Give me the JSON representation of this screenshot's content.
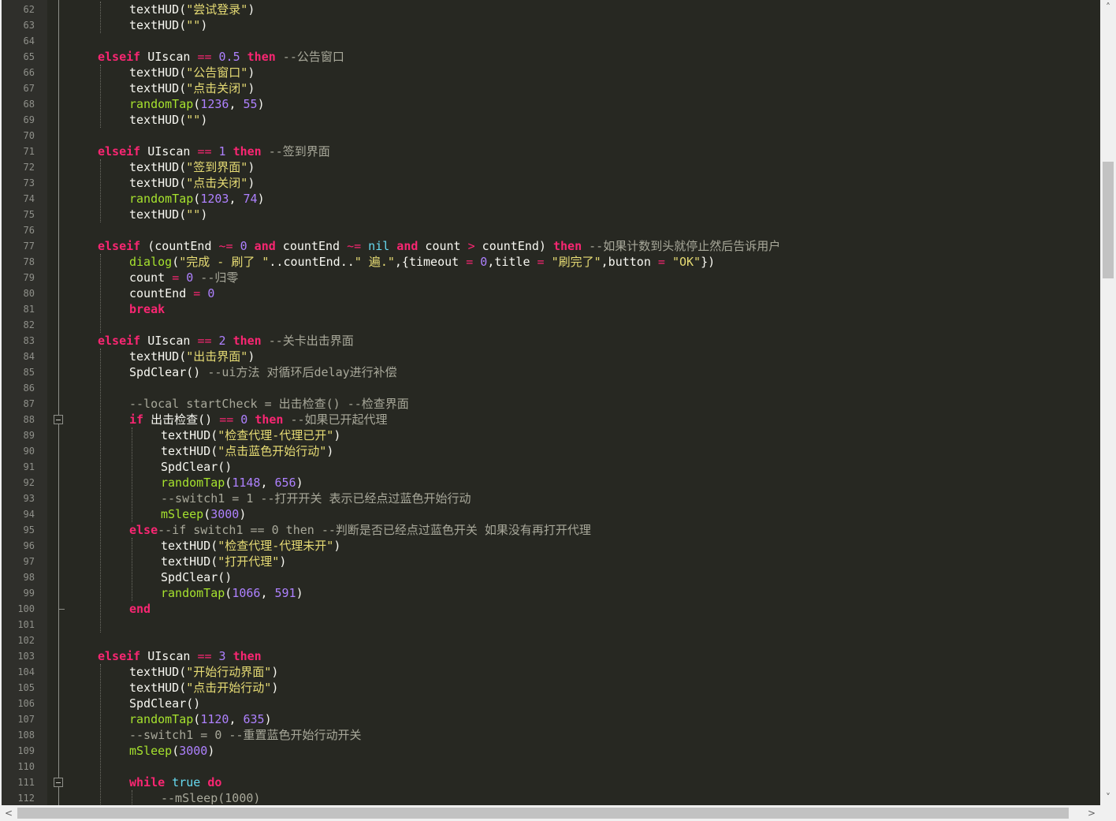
{
  "editor": {
    "lines": [
      {
        "n": "62",
        "indent": 2,
        "parts": [
          [
            "fn0",
            "textHUD("
          ],
          [
            "str",
            "\"尝试登录\""
          ],
          [
            "id",
            ")"
          ]
        ]
      },
      {
        "n": "63",
        "indent": 2,
        "parts": [
          [
            "id",
            "textHUD("
          ],
          [
            "str",
            "\"\""
          ],
          [
            "id",
            ")"
          ]
        ]
      },
      {
        "n": "64",
        "indent": 0,
        "parts": []
      },
      {
        "n": "65",
        "indent": 1,
        "parts": [
          [
            "kw",
            "elseif"
          ],
          [
            "id",
            " UIscan "
          ],
          [
            "op",
            "=="
          ],
          [
            "num",
            " 0.5"
          ],
          [
            "kw",
            " then"
          ],
          [
            "cmb",
            " --公告窗口"
          ]
        ]
      },
      {
        "n": "66",
        "indent": 2,
        "parts": [
          [
            "id",
            "textHUD("
          ],
          [
            "str",
            "\"公告窗口\""
          ],
          [
            "id",
            ")"
          ]
        ]
      },
      {
        "n": "67",
        "indent": 2,
        "parts": [
          [
            "id",
            "textHUD("
          ],
          [
            "str",
            "\"点击关闭\""
          ],
          [
            "id",
            ")"
          ]
        ]
      },
      {
        "n": "68",
        "indent": 2,
        "parts": [
          [
            "fn",
            "randomTap"
          ],
          [
            "id",
            "("
          ],
          [
            "num",
            "1236"
          ],
          [
            "id",
            ", "
          ],
          [
            "num",
            "55"
          ],
          [
            "id",
            ")"
          ]
        ]
      },
      {
        "n": "69",
        "indent": 2,
        "parts": [
          [
            "id",
            "textHUD("
          ],
          [
            "str",
            "\"\""
          ],
          [
            "id",
            ")"
          ]
        ]
      },
      {
        "n": "70",
        "indent": 0,
        "parts": []
      },
      {
        "n": "71",
        "indent": 1,
        "parts": [
          [
            "kw",
            "elseif"
          ],
          [
            "id",
            " UIscan "
          ],
          [
            "op",
            "=="
          ],
          [
            "num",
            " 1"
          ],
          [
            "kw",
            " then"
          ],
          [
            "cmb",
            " --签到界面"
          ]
        ]
      },
      {
        "n": "72",
        "indent": 2,
        "parts": [
          [
            "id",
            "textHUD("
          ],
          [
            "str",
            "\"签到界面\""
          ],
          [
            "id",
            ")"
          ]
        ]
      },
      {
        "n": "73",
        "indent": 2,
        "parts": [
          [
            "id",
            "textHUD("
          ],
          [
            "str",
            "\"点击关闭\""
          ],
          [
            "id",
            ")"
          ]
        ]
      },
      {
        "n": "74",
        "indent": 2,
        "parts": [
          [
            "fn",
            "randomTap"
          ],
          [
            "id",
            "("
          ],
          [
            "num",
            "1203"
          ],
          [
            "id",
            ", "
          ],
          [
            "num",
            "74"
          ],
          [
            "id",
            ")"
          ]
        ]
      },
      {
        "n": "75",
        "indent": 2,
        "parts": [
          [
            "id",
            "textHUD("
          ],
          [
            "str",
            "\"\""
          ],
          [
            "id",
            ")"
          ]
        ]
      },
      {
        "n": "76",
        "indent": 0,
        "parts": []
      },
      {
        "n": "77",
        "indent": 1,
        "parts": [
          [
            "kw",
            "elseif"
          ],
          [
            "id",
            " (countEnd "
          ],
          [
            "op",
            "~="
          ],
          [
            "num",
            " 0"
          ],
          [
            "kw",
            " and"
          ],
          [
            "id",
            " countEnd "
          ],
          [
            "op",
            "~="
          ],
          [
            "cy",
            " nil"
          ],
          [
            "kw",
            " and"
          ],
          [
            "id",
            " count "
          ],
          [
            "op",
            ">"
          ],
          [
            "id",
            " countEnd) "
          ],
          [
            "kw",
            "then"
          ],
          [
            "cmb",
            " --如果计数到头就停止然后告诉用户"
          ]
        ]
      },
      {
        "n": "78",
        "indent": 2,
        "parts": [
          [
            "fn",
            "dialog"
          ],
          [
            "id",
            "("
          ],
          [
            "str",
            "\"完成 - 刷了 \""
          ],
          [
            "id",
            "..countEnd.."
          ],
          [
            "str",
            "\" 遍.\""
          ],
          [
            "id",
            ",{timeout "
          ],
          [
            "op",
            "="
          ],
          [
            "num",
            " 0"
          ],
          [
            "id",
            ",title "
          ],
          [
            "op",
            "="
          ],
          [
            "str",
            " \"刷完了\""
          ],
          [
            "id",
            ",button "
          ],
          [
            "op",
            "="
          ],
          [
            "str",
            " \"OK\""
          ],
          [
            "id",
            "})"
          ]
        ]
      },
      {
        "n": "79",
        "indent": 2,
        "parts": [
          [
            "id",
            "count "
          ],
          [
            "op",
            "="
          ],
          [
            "num",
            " 0"
          ],
          [
            "cmb",
            " --归零"
          ]
        ]
      },
      {
        "n": "80",
        "indent": 2,
        "parts": [
          [
            "id",
            "countEnd "
          ],
          [
            "op",
            "="
          ],
          [
            "num",
            " 0"
          ]
        ]
      },
      {
        "n": "81",
        "indent": 2,
        "parts": [
          [
            "kw",
            "break"
          ]
        ]
      },
      {
        "n": "82",
        "indent": 0,
        "parts": []
      },
      {
        "n": "83",
        "indent": 1,
        "parts": [
          [
            "kw",
            "elseif"
          ],
          [
            "id",
            " UIscan "
          ],
          [
            "op",
            "=="
          ],
          [
            "num",
            " 2"
          ],
          [
            "kw",
            " then"
          ],
          [
            "cmb",
            " --关卡出击界面"
          ]
        ]
      },
      {
        "n": "84",
        "indent": 2,
        "parts": [
          [
            "id",
            "textHUD("
          ],
          [
            "str",
            "\"出击界面\""
          ],
          [
            "id",
            ")"
          ]
        ]
      },
      {
        "n": "85",
        "indent": 2,
        "parts": [
          [
            "id",
            "SpdClear() "
          ],
          [
            "cmb",
            "--ui方法 对循环后delay进行补偿"
          ]
        ]
      },
      {
        "n": "86",
        "indent": 0,
        "parts": []
      },
      {
        "n": "87",
        "indent": 2,
        "parts": [
          [
            "cmb",
            "--local startCheck = 出击检查() --检查界面"
          ]
        ]
      },
      {
        "n": "88",
        "indent": 2,
        "parts": [
          [
            "kw",
            "if"
          ],
          [
            "id",
            " 出击检查() "
          ],
          [
            "op",
            "=="
          ],
          [
            "num",
            " 0"
          ],
          [
            "kw",
            " then"
          ],
          [
            "cmb",
            " --如果已开起代理"
          ]
        ]
      },
      {
        "n": "89",
        "indent": 3,
        "parts": [
          [
            "id",
            "textHUD("
          ],
          [
            "str",
            "\"检查代理-代理已开\""
          ],
          [
            "id",
            ")"
          ]
        ]
      },
      {
        "n": "90",
        "indent": 3,
        "parts": [
          [
            "id",
            "textHUD("
          ],
          [
            "str",
            "\"点击蓝色开始行动\""
          ],
          [
            "id",
            ")"
          ]
        ]
      },
      {
        "n": "91",
        "indent": 3,
        "parts": [
          [
            "id",
            "SpdClear()"
          ]
        ]
      },
      {
        "n": "92",
        "indent": 3,
        "parts": [
          [
            "fn",
            "randomTap"
          ],
          [
            "id",
            "("
          ],
          [
            "num",
            "1148"
          ],
          [
            "id",
            ", "
          ],
          [
            "num",
            "656"
          ],
          [
            "id",
            ")"
          ]
        ]
      },
      {
        "n": "93",
        "indent": 3,
        "parts": [
          [
            "cmb",
            "--switch1 = 1 --打开开关 表示已经点过蓝色开始行动"
          ]
        ]
      },
      {
        "n": "94",
        "indent": 3,
        "parts": [
          [
            "fn",
            "mSleep"
          ],
          [
            "id",
            "("
          ],
          [
            "num",
            "3000"
          ],
          [
            "id",
            ")"
          ]
        ]
      },
      {
        "n": "95",
        "indent": 2,
        "parts": [
          [
            "kw",
            "else"
          ],
          [
            "cmb",
            "--if switch1 == 0 then --判断是否已经点过蓝色开关 如果没有再打开代理"
          ]
        ]
      },
      {
        "n": "96",
        "indent": 3,
        "parts": [
          [
            "id",
            "textHUD("
          ],
          [
            "str",
            "\"检查代理-代理未开\""
          ],
          [
            "id",
            ")"
          ]
        ]
      },
      {
        "n": "97",
        "indent": 3,
        "parts": [
          [
            "id",
            "textHUD("
          ],
          [
            "str",
            "\"打开代理\""
          ],
          [
            "id",
            ")"
          ]
        ]
      },
      {
        "n": "98",
        "indent": 3,
        "parts": [
          [
            "id",
            "SpdClear()"
          ]
        ]
      },
      {
        "n": "99",
        "indent": 3,
        "parts": [
          [
            "fn",
            "randomTap"
          ],
          [
            "id",
            "("
          ],
          [
            "num",
            "1066"
          ],
          [
            "id",
            ", "
          ],
          [
            "num",
            "591"
          ],
          [
            "id",
            ")"
          ]
        ]
      },
      {
        "n": "100",
        "indent": 2,
        "parts": [
          [
            "kw",
            "end"
          ]
        ]
      },
      {
        "n": "101",
        "indent": 0,
        "parts": []
      },
      {
        "n": "102",
        "indent": 0,
        "parts": []
      },
      {
        "n": "103",
        "indent": 1,
        "parts": [
          [
            "kw",
            "elseif"
          ],
          [
            "id",
            " UIscan "
          ],
          [
            "op",
            "=="
          ],
          [
            "num",
            " 3"
          ],
          [
            "kw",
            " then"
          ]
        ]
      },
      {
        "n": "104",
        "indent": 2,
        "parts": [
          [
            "id",
            "textHUD("
          ],
          [
            "str",
            "\"开始行动界面\""
          ],
          [
            "id",
            ")"
          ]
        ]
      },
      {
        "n": "105",
        "indent": 2,
        "parts": [
          [
            "id",
            "textHUD("
          ],
          [
            "str",
            "\"点击开始行动\""
          ],
          [
            "id",
            ")"
          ]
        ]
      },
      {
        "n": "106",
        "indent": 2,
        "parts": [
          [
            "id",
            "SpdClear()"
          ]
        ]
      },
      {
        "n": "107",
        "indent": 2,
        "parts": [
          [
            "fn",
            "randomTap"
          ],
          [
            "id",
            "("
          ],
          [
            "num",
            "1120"
          ],
          [
            "id",
            ", "
          ],
          [
            "num",
            "635"
          ],
          [
            "id",
            ")"
          ]
        ]
      },
      {
        "n": "108",
        "indent": 2,
        "parts": [
          [
            "cmb",
            "--switch1 = 0 --重置蓝色开始行动开关"
          ]
        ]
      },
      {
        "n": "109",
        "indent": 2,
        "parts": [
          [
            "fn",
            "mSleep"
          ],
          [
            "id",
            "("
          ],
          [
            "num",
            "3000"
          ],
          [
            "id",
            ")"
          ]
        ]
      },
      {
        "n": "110",
        "indent": 0,
        "parts": []
      },
      {
        "n": "111",
        "indent": 2,
        "parts": [
          [
            "kw",
            "while"
          ],
          [
            "cy",
            " true"
          ],
          [
            "kw",
            " do"
          ]
        ]
      },
      {
        "n": "112",
        "indent": 3,
        "parts": [
          [
            "cmb",
            "--mSleep(1000)"
          ]
        ]
      }
    ]
  },
  "scrollbars": {
    "left_arrow": "<",
    "right_arrow": ">",
    "up_arrow": "^",
    "down_arrow": "v"
  }
}
